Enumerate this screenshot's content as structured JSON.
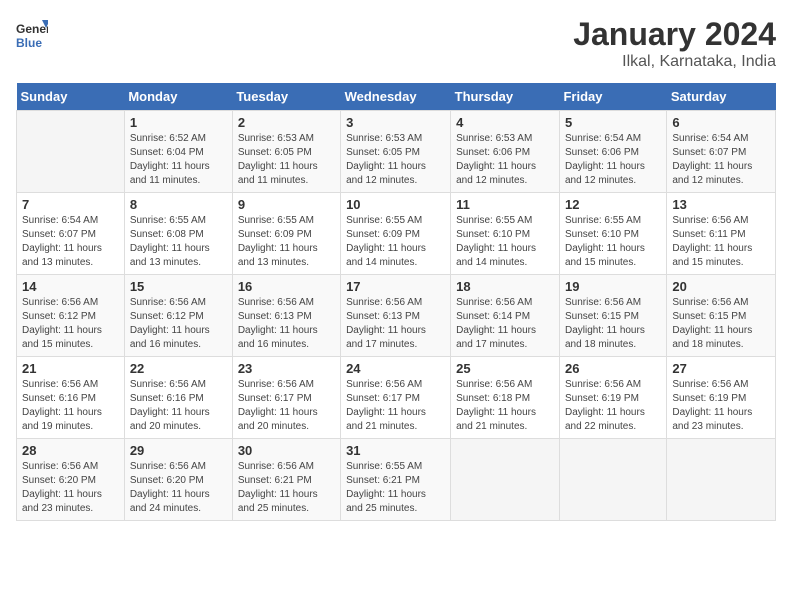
{
  "logo": {
    "text_general": "General",
    "text_blue": "Blue"
  },
  "title": "January 2024",
  "subtitle": "Ilkal, Karnataka, India",
  "days_header": [
    "Sunday",
    "Monday",
    "Tuesday",
    "Wednesday",
    "Thursday",
    "Friday",
    "Saturday"
  ],
  "weeks": [
    [
      {
        "num": "",
        "detail": ""
      },
      {
        "num": "1",
        "detail": "Sunrise: 6:52 AM\nSunset: 6:04 PM\nDaylight: 11 hours\nand 11 minutes."
      },
      {
        "num": "2",
        "detail": "Sunrise: 6:53 AM\nSunset: 6:05 PM\nDaylight: 11 hours\nand 11 minutes."
      },
      {
        "num": "3",
        "detail": "Sunrise: 6:53 AM\nSunset: 6:05 PM\nDaylight: 11 hours\nand 12 minutes."
      },
      {
        "num": "4",
        "detail": "Sunrise: 6:53 AM\nSunset: 6:06 PM\nDaylight: 11 hours\nand 12 minutes."
      },
      {
        "num": "5",
        "detail": "Sunrise: 6:54 AM\nSunset: 6:06 PM\nDaylight: 11 hours\nand 12 minutes."
      },
      {
        "num": "6",
        "detail": "Sunrise: 6:54 AM\nSunset: 6:07 PM\nDaylight: 11 hours\nand 12 minutes."
      }
    ],
    [
      {
        "num": "7",
        "detail": "Sunrise: 6:54 AM\nSunset: 6:07 PM\nDaylight: 11 hours\nand 13 minutes."
      },
      {
        "num": "8",
        "detail": "Sunrise: 6:55 AM\nSunset: 6:08 PM\nDaylight: 11 hours\nand 13 minutes."
      },
      {
        "num": "9",
        "detail": "Sunrise: 6:55 AM\nSunset: 6:09 PM\nDaylight: 11 hours\nand 13 minutes."
      },
      {
        "num": "10",
        "detail": "Sunrise: 6:55 AM\nSunset: 6:09 PM\nDaylight: 11 hours\nand 14 minutes."
      },
      {
        "num": "11",
        "detail": "Sunrise: 6:55 AM\nSunset: 6:10 PM\nDaylight: 11 hours\nand 14 minutes."
      },
      {
        "num": "12",
        "detail": "Sunrise: 6:55 AM\nSunset: 6:10 PM\nDaylight: 11 hours\nand 15 minutes."
      },
      {
        "num": "13",
        "detail": "Sunrise: 6:56 AM\nSunset: 6:11 PM\nDaylight: 11 hours\nand 15 minutes."
      }
    ],
    [
      {
        "num": "14",
        "detail": "Sunrise: 6:56 AM\nSunset: 6:12 PM\nDaylight: 11 hours\nand 15 minutes."
      },
      {
        "num": "15",
        "detail": "Sunrise: 6:56 AM\nSunset: 6:12 PM\nDaylight: 11 hours\nand 16 minutes."
      },
      {
        "num": "16",
        "detail": "Sunrise: 6:56 AM\nSunset: 6:13 PM\nDaylight: 11 hours\nand 16 minutes."
      },
      {
        "num": "17",
        "detail": "Sunrise: 6:56 AM\nSunset: 6:13 PM\nDaylight: 11 hours\nand 17 minutes."
      },
      {
        "num": "18",
        "detail": "Sunrise: 6:56 AM\nSunset: 6:14 PM\nDaylight: 11 hours\nand 17 minutes."
      },
      {
        "num": "19",
        "detail": "Sunrise: 6:56 AM\nSunset: 6:15 PM\nDaylight: 11 hours\nand 18 minutes."
      },
      {
        "num": "20",
        "detail": "Sunrise: 6:56 AM\nSunset: 6:15 PM\nDaylight: 11 hours\nand 18 minutes."
      }
    ],
    [
      {
        "num": "21",
        "detail": "Sunrise: 6:56 AM\nSunset: 6:16 PM\nDaylight: 11 hours\nand 19 minutes."
      },
      {
        "num": "22",
        "detail": "Sunrise: 6:56 AM\nSunset: 6:16 PM\nDaylight: 11 hours\nand 20 minutes."
      },
      {
        "num": "23",
        "detail": "Sunrise: 6:56 AM\nSunset: 6:17 PM\nDaylight: 11 hours\nand 20 minutes."
      },
      {
        "num": "24",
        "detail": "Sunrise: 6:56 AM\nSunset: 6:17 PM\nDaylight: 11 hours\nand 21 minutes."
      },
      {
        "num": "25",
        "detail": "Sunrise: 6:56 AM\nSunset: 6:18 PM\nDaylight: 11 hours\nand 21 minutes."
      },
      {
        "num": "26",
        "detail": "Sunrise: 6:56 AM\nSunset: 6:19 PM\nDaylight: 11 hours\nand 22 minutes."
      },
      {
        "num": "27",
        "detail": "Sunrise: 6:56 AM\nSunset: 6:19 PM\nDaylight: 11 hours\nand 23 minutes."
      }
    ],
    [
      {
        "num": "28",
        "detail": "Sunrise: 6:56 AM\nSunset: 6:20 PM\nDaylight: 11 hours\nand 23 minutes."
      },
      {
        "num": "29",
        "detail": "Sunrise: 6:56 AM\nSunset: 6:20 PM\nDaylight: 11 hours\nand 24 minutes."
      },
      {
        "num": "30",
        "detail": "Sunrise: 6:56 AM\nSunset: 6:21 PM\nDaylight: 11 hours\nand 25 minutes."
      },
      {
        "num": "31",
        "detail": "Sunrise: 6:55 AM\nSunset: 6:21 PM\nDaylight: 11 hours\nand 25 minutes."
      },
      {
        "num": "",
        "detail": ""
      },
      {
        "num": "",
        "detail": ""
      },
      {
        "num": "",
        "detail": ""
      }
    ]
  ]
}
